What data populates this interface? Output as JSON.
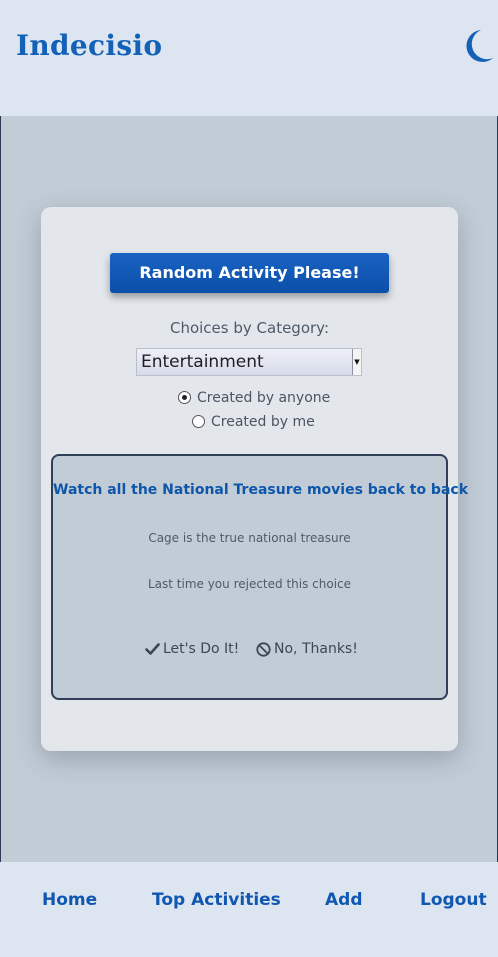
{
  "header": {
    "brand": "Indecisio",
    "theme_icon": "moon-icon"
  },
  "card": {
    "random_button": "Random Activity Please!",
    "category_label": "Choices by Category:",
    "category_select": "Entertainment",
    "radios": [
      {
        "label": "Created by anyone",
        "checked": true
      },
      {
        "label": "Created by me",
        "checked": false
      }
    ],
    "activity": {
      "title": "Watch all the National Treasure movies back to back",
      "description": "Cage is the true national treasure",
      "note": "Last time you rejected this choice",
      "accept_label": "Let's Do It!",
      "accept_icon": "check-icon",
      "reject_label": "No, Thanks!",
      "reject_icon": "ban-icon"
    }
  },
  "nav": {
    "items": [
      "Home",
      "Top Activities",
      "Add",
      "Logout"
    ]
  },
  "colors": {
    "accent": "#0f57b0",
    "header_bg": "#dde6f0",
    "page_bg": "#c2ccd6",
    "card_bg": "#e3e7ec"
  }
}
